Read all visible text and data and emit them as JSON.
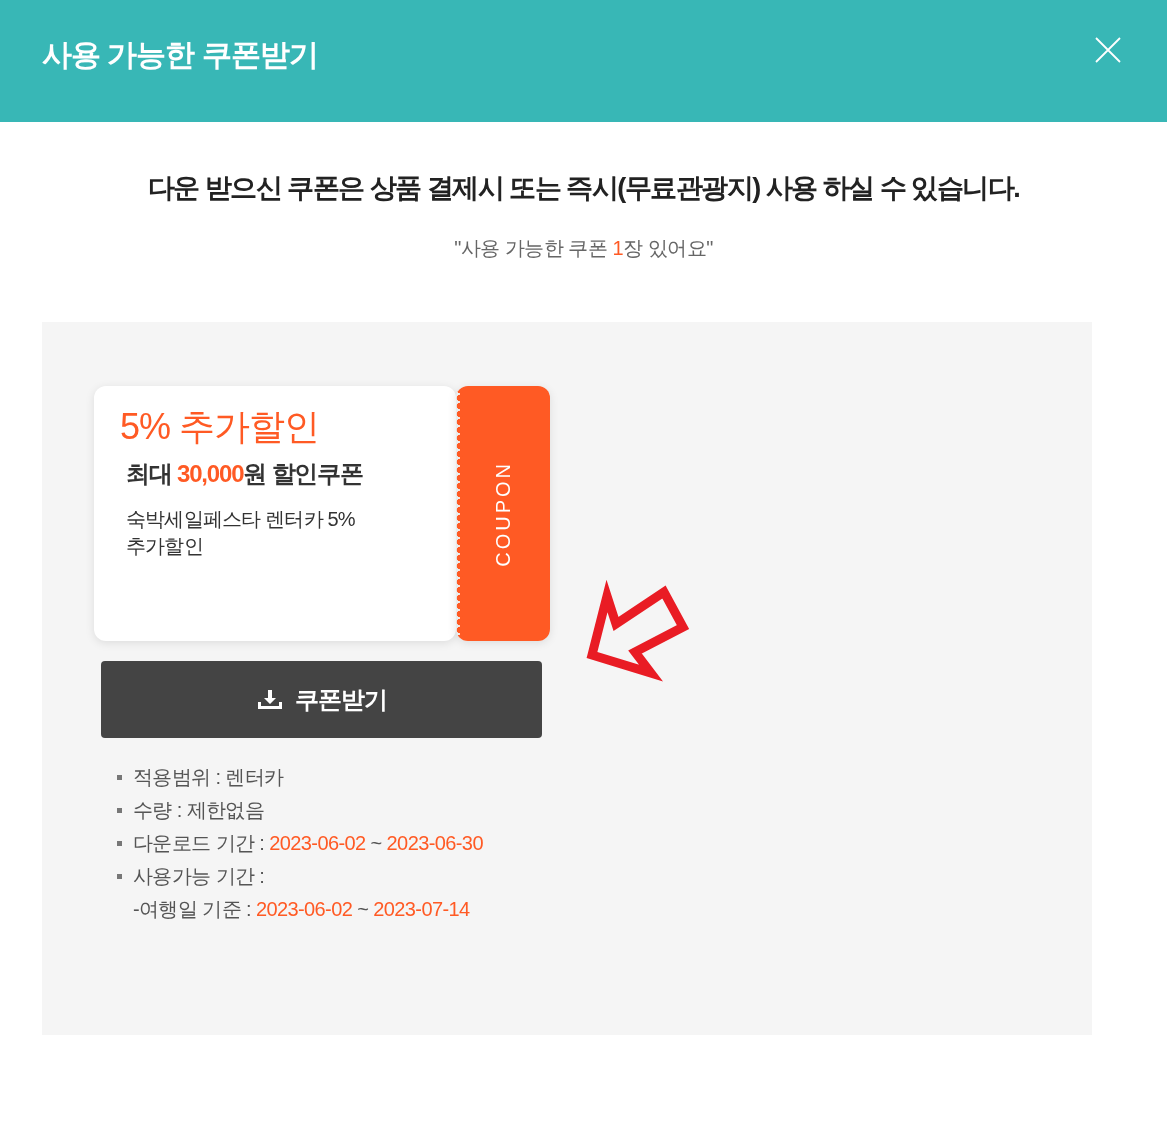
{
  "header": {
    "title": "사용 가능한 쿠폰받기"
  },
  "notice": {
    "headline": "다운 받으신 쿠폰은 상품 결제시 또는 즉시(무료관광지) 사용 하실 수 있습니다.",
    "count_text": {
      "prefix": "\"사용 가능한 쿠폰",
      "count": "1",
      "suffix": "장 있어요\""
    }
  },
  "coupon": {
    "title": "5% 추가할인",
    "max_discount": {
      "prefix": "최대",
      "amount": "30,000",
      "suffix": "원 할인쿠폰"
    },
    "description": "숙박세일페스타 렌터카 5% 추가할인",
    "stub_label": "COUPON"
  },
  "download_button": {
    "label": "쿠폰받기"
  },
  "details": [
    {
      "kind": "text",
      "label": "적용범위 : 렌터카"
    },
    {
      "kind": "text",
      "label": "수량 : 제한없음"
    },
    {
      "kind": "period",
      "label": "다운로드 기간 :",
      "from": "2023-06-02",
      "separator": "~",
      "to": "2023-06-30"
    },
    {
      "kind": "text",
      "label": "사용가능 기간 :",
      "children": [
        {
          "kind": "period",
          "label": "-여행일 기준 :",
          "from": "2023-06-02",
          "separator": "~",
          "to": "2023-07-14"
        }
      ]
    }
  ]
}
